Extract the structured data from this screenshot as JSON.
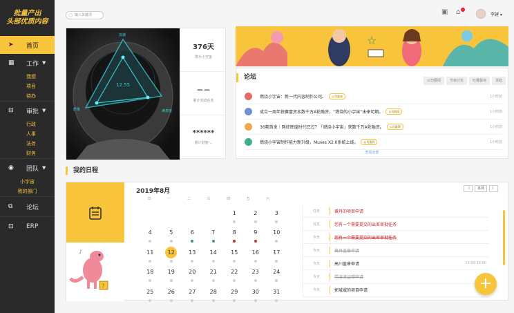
{
  "logo": {
    "line1": "批量产出",
    "line2": "头部优质内容"
  },
  "topbar": {
    "search_placeholder": "输入关键词",
    "user_name": "李建 ▾"
  },
  "sidebar": {
    "home": "首页",
    "work": {
      "label": "工作",
      "items": [
        "我想",
        "项目",
        "待办"
      ]
    },
    "approve": {
      "label": "审批",
      "items": [
        "行政",
        "人事",
        "法务",
        "财务"
      ]
    },
    "team": {
      "label": "团队",
      "items": [
        "小宇宙",
        "我的部门"
      ]
    },
    "forum": "论坛",
    "erp": "ERP"
  },
  "astronaut": {
    "labels": {
      "top": "加速",
      "left": "质量",
      "right": "满意度",
      "center": "12.55"
    },
    "stats": [
      {
        "value": "376天",
        "label": "携手小宇宙"
      },
      {
        "value": "－－",
        "label": "累计完成任务"
      },
      {
        "value": "******",
        "label": "累计财富"
      }
    ]
  },
  "forum": {
    "title": "论坛",
    "tabs": [
      "公司要闻",
      "节目讨论",
      "吐槽基地",
      "求助"
    ],
    "posts": [
      {
        "text": "燃烧小宇宙：新一代内容制作公司。",
        "tag": "公司要闻",
        "time": "1小时前",
        "color": "#e56b6b"
      },
      {
        "text": "成立一周年获赛富资本数千万A轮融资，“燃烧的小宇宙”未来可期。",
        "tag": "公司要闻",
        "time": "1小时前",
        "color": "#6f8fd6"
      },
      {
        "text": "36氪首发｜网综辉煌时代已过？「燃烧小宇宙」获数千万A轮融资。",
        "tag": "公司要闻",
        "time": "1小时前",
        "color": "#f0a94a"
      },
      {
        "text": "燃烧小宇宙制作能力新升级，Muses X2.0系统上线。",
        "tag": "公司要闻",
        "time": "1小时前",
        "color": "#3fae8c"
      }
    ],
    "more": "查看全部"
  },
  "schedule": {
    "title": "我的日程",
    "month": "2019年8月",
    "nav": {
      "prev": "〈",
      "today": "本月",
      "next": "〉"
    },
    "weekdays": [
      "日",
      "一",
      "二",
      "三",
      "四",
      "五",
      "六"
    ],
    "weeks": [
      [
        {
          "d": ""
        },
        {
          "d": ""
        },
        {
          "d": ""
        },
        {
          "d": ""
        },
        {
          "d": "1",
          "m": "grey"
        },
        {
          "d": "2",
          "m": "grey"
        },
        {
          "d": "3",
          "m": "grey"
        }
      ],
      [
        {
          "d": "4",
          "m": "grey"
        },
        {
          "d": "5",
          "m": "grey"
        },
        {
          "d": "6",
          "m": "green"
        },
        {
          "d": "7",
          "m": "green"
        },
        {
          "d": "8",
          "m": "red"
        },
        {
          "d": "9",
          "m": "red"
        },
        {
          "d": "10",
          "m": "grey"
        }
      ],
      [
        {
          "d": "11",
          "m": "grey"
        },
        {
          "d": "12",
          "m": "grey",
          "today": true
        },
        {
          "d": "13",
          "m": "grey"
        },
        {
          "d": "14",
          "m": "grey"
        },
        {
          "d": "15",
          "m": "grey"
        },
        {
          "d": "16",
          "m": "grey"
        },
        {
          "d": "17",
          "m": "grey"
        }
      ],
      [
        {
          "d": "18",
          "m": "grey"
        },
        {
          "d": "19",
          "m": "grey"
        },
        {
          "d": "20",
          "m": "grey"
        },
        {
          "d": "21",
          "m": "grey"
        },
        {
          "d": "22",
          "m": "grey"
        },
        {
          "d": "23",
          "m": "grey"
        },
        {
          "d": "24",
          "m": "grey"
        }
      ],
      [
        {
          "d": "25",
          "m": "grey"
        },
        {
          "d": "26",
          "m": "grey"
        },
        {
          "d": "27",
          "m": "grey"
        },
        {
          "d": "28",
          "m": "grey"
        },
        {
          "d": "29",
          "m": "grey"
        },
        {
          "d": "30",
          "m": "grey"
        },
        {
          "d": "31",
          "m": "grey"
        }
      ]
    ],
    "events": [
      {
        "cat": "任务",
        "text": "黄丹的项目申请",
        "style": "red",
        "time": ""
      },
      {
        "cat": "任务",
        "text": "您有一个需要提交的出差审批任务",
        "style": "red",
        "time": ""
      },
      {
        "cat": "今天",
        "text": "您有一个需要提交的出差审批任务",
        "style": "red strike",
        "time": ""
      },
      {
        "cat": "今天",
        "text": "黄丹盖章申请",
        "style": "strike",
        "time": ""
      },
      {
        "cat": "今天",
        "text": "高川盖章申请",
        "style": "",
        "time": "13:00-15:00"
      },
      {
        "cat": "今天",
        "text": "带津津证照申请",
        "style": "strike",
        "time": ""
      },
      {
        "cat": "今天",
        "text": "郭城城的项目申请",
        "style": "",
        "time": ""
      }
    ]
  },
  "fab": "+",
  "colors": {
    "accent": "#f7c43c",
    "sidebar": "#2a2a2a",
    "danger": "#c52a2a"
  }
}
